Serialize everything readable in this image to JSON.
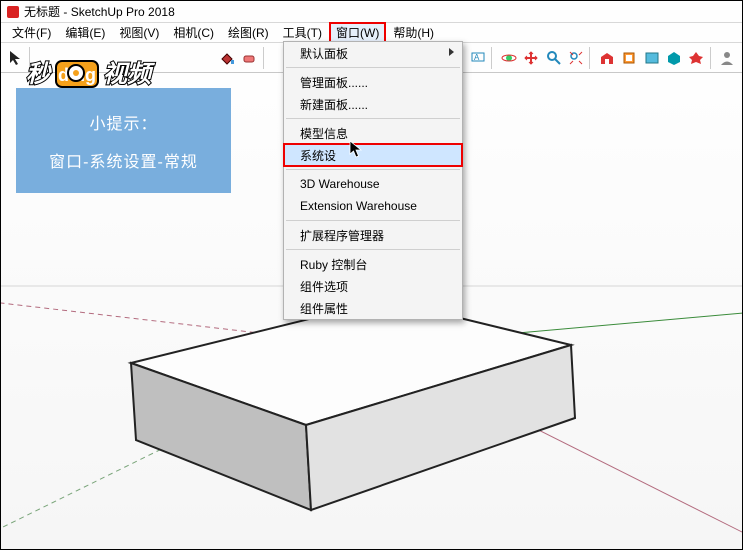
{
  "title": {
    "doc": "无标题",
    "app": "SketchUp Pro 2018"
  },
  "menus": {
    "file": "文件(F)",
    "edit": "编辑(E)",
    "view": "视图(V)",
    "camera": "相机(C)",
    "draw": "绘图(R)",
    "tools": "工具(T)",
    "window": "窗口(W)",
    "help": "帮助(H)"
  },
  "dropdown": {
    "default_tray": "默认面板",
    "manage_trays": "管理面板......",
    "new_tray": "新建面板......",
    "model_info": "模型信息",
    "preferences": "系统设",
    "warehouse_3d": "3D Warehouse",
    "ext_warehouse": "Extension Warehouse",
    "ext_manager": "扩展程序管理器",
    "ruby_console": "Ruby 控制台",
    "component_opts": "组件选项",
    "component_attrs": "组件属性"
  },
  "tip": {
    "title": "小提示：",
    "body": "窗口-系统设置-常规"
  },
  "watermark": "秒dong视频"
}
